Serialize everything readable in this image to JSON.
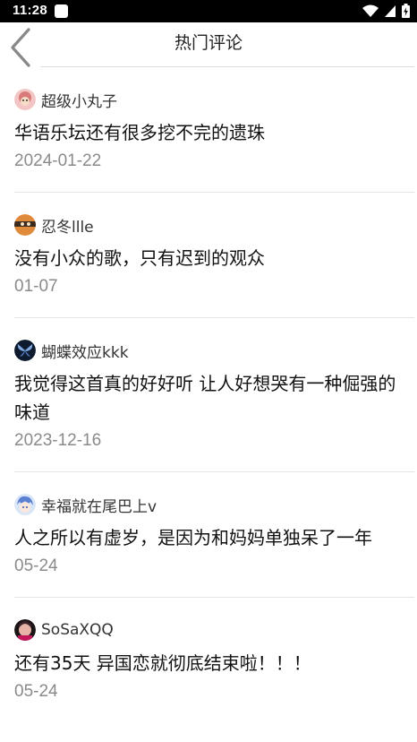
{
  "status_bar": {
    "time": "11:28",
    "icons": [
      "notification-icon",
      "wifi-icon",
      "signal-icon",
      "battery-icon"
    ]
  },
  "header": {
    "title": "热门评论",
    "back_icon": "chevron-left-icon"
  },
  "comments": [
    {
      "username": "超级小丸子",
      "content": "华语乐坛还有很多挖不完的遗珠",
      "date": "2024-01-22"
    },
    {
      "username": "忍冬llle",
      "content": "没有小众的歌，只有迟到的观众",
      "date": "01-07"
    },
    {
      "username": "蝴蝶效应kkk",
      "content": "我觉得这首真的好好听 让人好想哭有一种倔强的味道",
      "date": "2023-12-16"
    },
    {
      "username": "幸福就在尾巴上v",
      "content": "人之所以有虚岁，是因为和妈妈单独呆了一年",
      "date": "05-24"
    },
    {
      "username": "SoSaXQQ",
      "content": "还有35天 异国恋就彻底结束啦！！！",
      "date": "05-24"
    }
  ],
  "colors": {
    "status_bar": "#000000",
    "divider": "#e4e4e4",
    "date_text": "#8a8a8a",
    "content_text": "#111111"
  }
}
